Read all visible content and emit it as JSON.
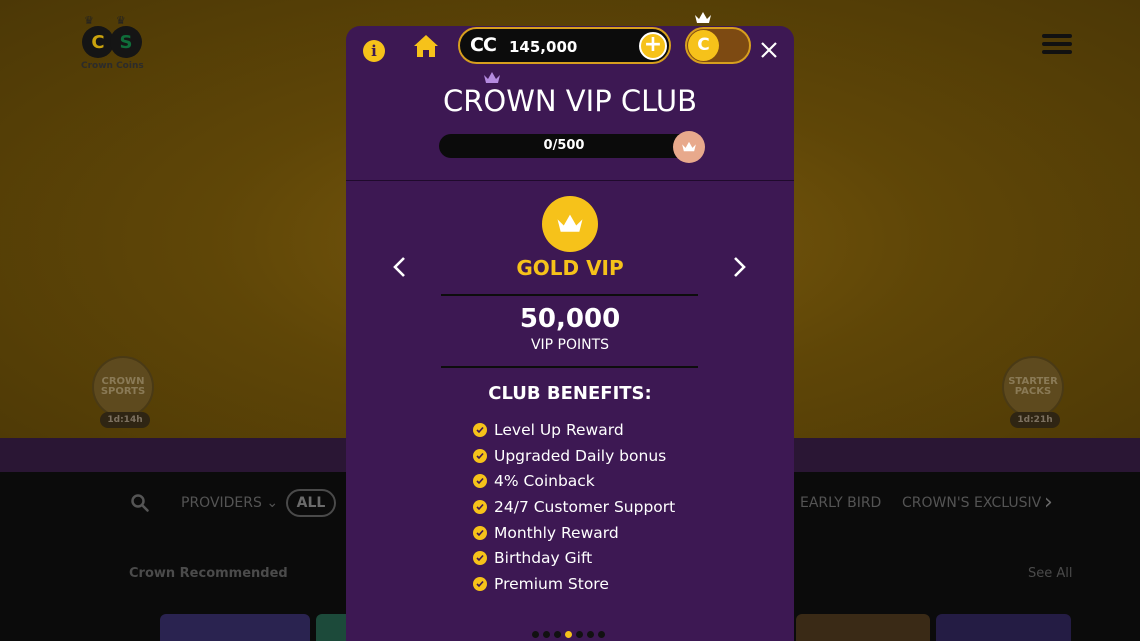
{
  "background": {
    "logo_text": "Crown Coins",
    "promo_left": {
      "label": "CROWN SPORTS",
      "timer": "1d:14h"
    },
    "promo_right": {
      "label": "STARTER PACKS",
      "timer": "1d:21h"
    },
    "filters": {
      "providers_label": "PROVIDERS",
      "all_label": "ALL",
      "tab_early_bird": "EARLY BIRD",
      "tab_crowns_exclusive": "CROWN'S EXCLUSIVE"
    },
    "recommended_title": "Crown Recommended",
    "see_all": "See All"
  },
  "modal": {
    "balance": {
      "currency": "CC",
      "amount": "145,000"
    },
    "coin_toggle_letter": "C",
    "title": "CROWN VIP CLUB",
    "progress": {
      "label": "0/500",
      "fraction": 0
    },
    "tier": {
      "name": "GOLD VIP",
      "points": "50,000",
      "points_label": "VIP POINTS"
    },
    "benefits_title": "CLUB BENEFITS:",
    "benefits": [
      "Level Up Reward",
      "Upgraded Daily bonus",
      "4% Coinback",
      "24/7 Customer Support",
      "Monthly Reward",
      "Birthday Gift",
      "Premium Store"
    ],
    "pagination": {
      "count": 7,
      "active_index": 3
    }
  },
  "colors": {
    "accent_gold": "#f6c21a",
    "modal_purple": "#3d1853",
    "progress_peach": "#e8a98c"
  },
  "icons": {
    "info": "info-icon",
    "home": "home-icon",
    "add": "plus-icon",
    "close": "close-icon",
    "crown": "crown-icon",
    "check": "check-icon",
    "prev": "chevron-left-icon",
    "next": "chevron-right-icon",
    "search": "search-icon"
  }
}
